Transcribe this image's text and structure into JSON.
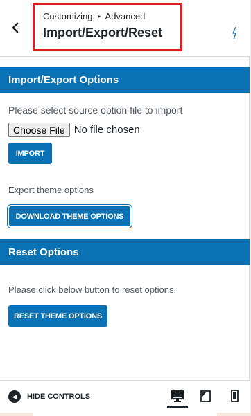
{
  "header": {
    "back_icon": "chevron-left-icon",
    "breadcrumb_parent": "Customizing",
    "breadcrumb_separator": "▸",
    "breadcrumb_current": "Advanced",
    "title": "Import/Export/Reset",
    "help_icon": "help-icon",
    "highlight_color": "#e21b23"
  },
  "import_export": {
    "section_title": "Import/Export Options",
    "import_instruction": "Please select source option file to import",
    "choose_file_label": "Choose File",
    "file_status": "No file chosen",
    "import_button": "IMPORT",
    "export_instruction": "Export theme options",
    "download_button": "DOWNLOAD THEME OPTIONS"
  },
  "reset": {
    "section_title": "Reset Options",
    "reset_instruction": "Please click below button to reset options.",
    "reset_button": "RESET THEME OPTIONS"
  },
  "footer": {
    "hide_controls_label": "HIDE CONTROLS",
    "devices": [
      "desktop",
      "tablet",
      "mobile"
    ],
    "active_device": "desktop"
  },
  "colors": {
    "accent": "#0a71b4",
    "text": "#50575e",
    "heading": "#1d2327"
  }
}
